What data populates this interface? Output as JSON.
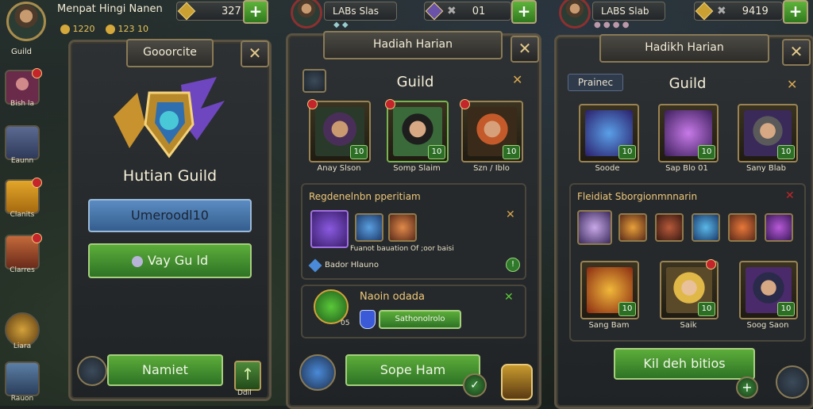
{
  "topbar": {
    "player_name": "Menpat Hingi Nanen",
    "player_level": "Guild",
    "currency_1": "327",
    "currency_2a": "1220",
    "currency_2b": "123 10",
    "mid_name": "LABs Slas",
    "mid_value": "01",
    "right_name": "LABS Slab",
    "right_value": "9419"
  },
  "sidebar": [
    {
      "label": "Bish la"
    },
    {
      "label": "Eaunn"
    },
    {
      "label": "Clanits"
    },
    {
      "label": "Clarres"
    },
    {
      "label": "Liara"
    },
    {
      "label": "Rauon"
    }
  ],
  "panel1": {
    "title": "Gooorcite",
    "guild_name": "Hutian Guild",
    "button_primary": "Umeroodl10",
    "button_secondary": "Vay Gu ld",
    "button_bottom": "Namiet",
    "corner_label": "Ddil"
  },
  "panel2": {
    "title": "Hadiah Harian",
    "header": "Guild",
    "heroes": [
      {
        "name": "Anay Slson",
        "level": "10"
      },
      {
        "name": "Somp Slaim",
        "level": "10"
      },
      {
        "name": "Szn / Iblo",
        "level": "10"
      }
    ],
    "section1_title": "Regdenelnbn pperitiam",
    "section1_desc": "Fuanot bauation Of ;oor baisi",
    "section1_label": "Bador Hlauno",
    "section2_title": "Naoin odada",
    "section2_button": "Sathonolrolo",
    "section2_count": "05",
    "button_bottom": "Sope Ham"
  },
  "panel3": {
    "title": "Hadikh Harian",
    "tag": "Prainec",
    "header": "Guild",
    "top_items": [
      {
        "name": "Soode",
        "level": "10"
      },
      {
        "name": "Sap Blo 01",
        "level": "10"
      },
      {
        "name": "Sany Blab",
        "level": "10"
      }
    ],
    "section_title": "Fleidiat  Sborgionmnnarin",
    "bottom_heroes": [
      {
        "name": "Sang Bam",
        "level": "10"
      },
      {
        "name": "Saik",
        "level": "10"
      },
      {
        "name": "Soog Saon",
        "level": "10"
      }
    ],
    "button_bottom": "Kil deh bitios"
  },
  "colors": {
    "accent_gold": "#d7a551",
    "button_green": "#3f8e2c",
    "button_blue": "#4a77a8",
    "notif_red": "#c3252a"
  }
}
